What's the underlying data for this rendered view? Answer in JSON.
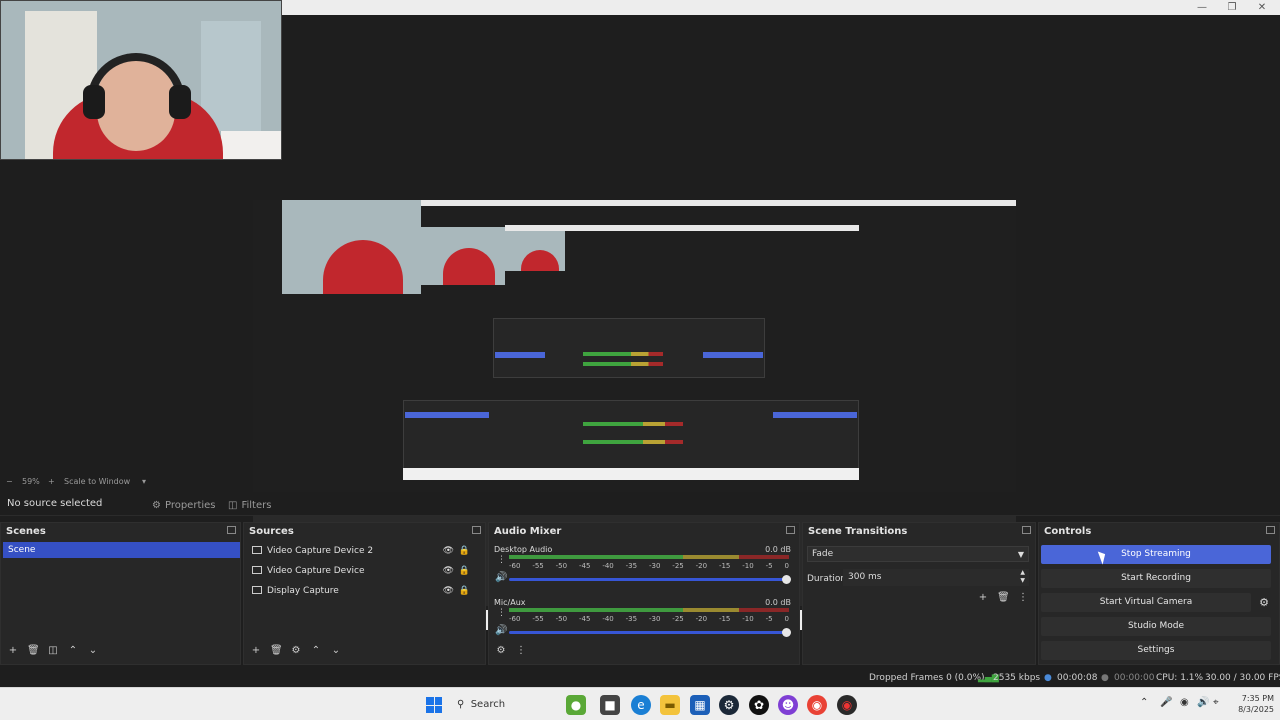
{
  "preview": {
    "zoom": "59%",
    "scale_mode": "Scale to Window"
  },
  "source_bar": {
    "no_source": "No source selected",
    "properties": "Properties",
    "filters": "Filters"
  },
  "scenes": {
    "title": "Scenes",
    "items": [
      "Scene"
    ]
  },
  "sources": {
    "title": "Sources",
    "items": [
      "Video Capture Device 2",
      "Video Capture Device",
      "Display Capture"
    ]
  },
  "mixer": {
    "title": "Audio Mixer",
    "channels": [
      {
        "name": "Desktop Audio",
        "db": "0.0 dB"
      },
      {
        "name": "Mic/Aux",
        "db": "0.0 dB"
      }
    ],
    "ticks": [
      "-60",
      "-55",
      "-50",
      "-45",
      "-40",
      "-35",
      "-30",
      "-25",
      "-20",
      "-15",
      "-10",
      "-5",
      "0"
    ]
  },
  "transitions": {
    "title": "Scene Transitions",
    "selected": "Fade",
    "duration_label": "Duration",
    "duration_value": "300 ms"
  },
  "controls": {
    "title": "Controls",
    "stop_streaming": "Stop Streaming",
    "start_recording": "Start Recording",
    "start_virtual_camera": "Start Virtual Camera",
    "studio_mode": "Studio Mode",
    "settings": "Settings"
  },
  "status": {
    "dropped": "Dropped Frames 0 (0.0%)",
    "bitrate": "2535 kbps",
    "stream_time": "00:00:08",
    "rec_time": "00:00:00",
    "cpu": "CPU: 1.1%",
    "fps": "30.00 / 30.00 FPS"
  },
  "taskbar": {
    "search": "Search",
    "time": "7:35 PM",
    "date": "8/3/2025"
  },
  "colors": {
    "accent": "#4a66d8",
    "panel": "#272727",
    "background": "#1e1e1e"
  }
}
